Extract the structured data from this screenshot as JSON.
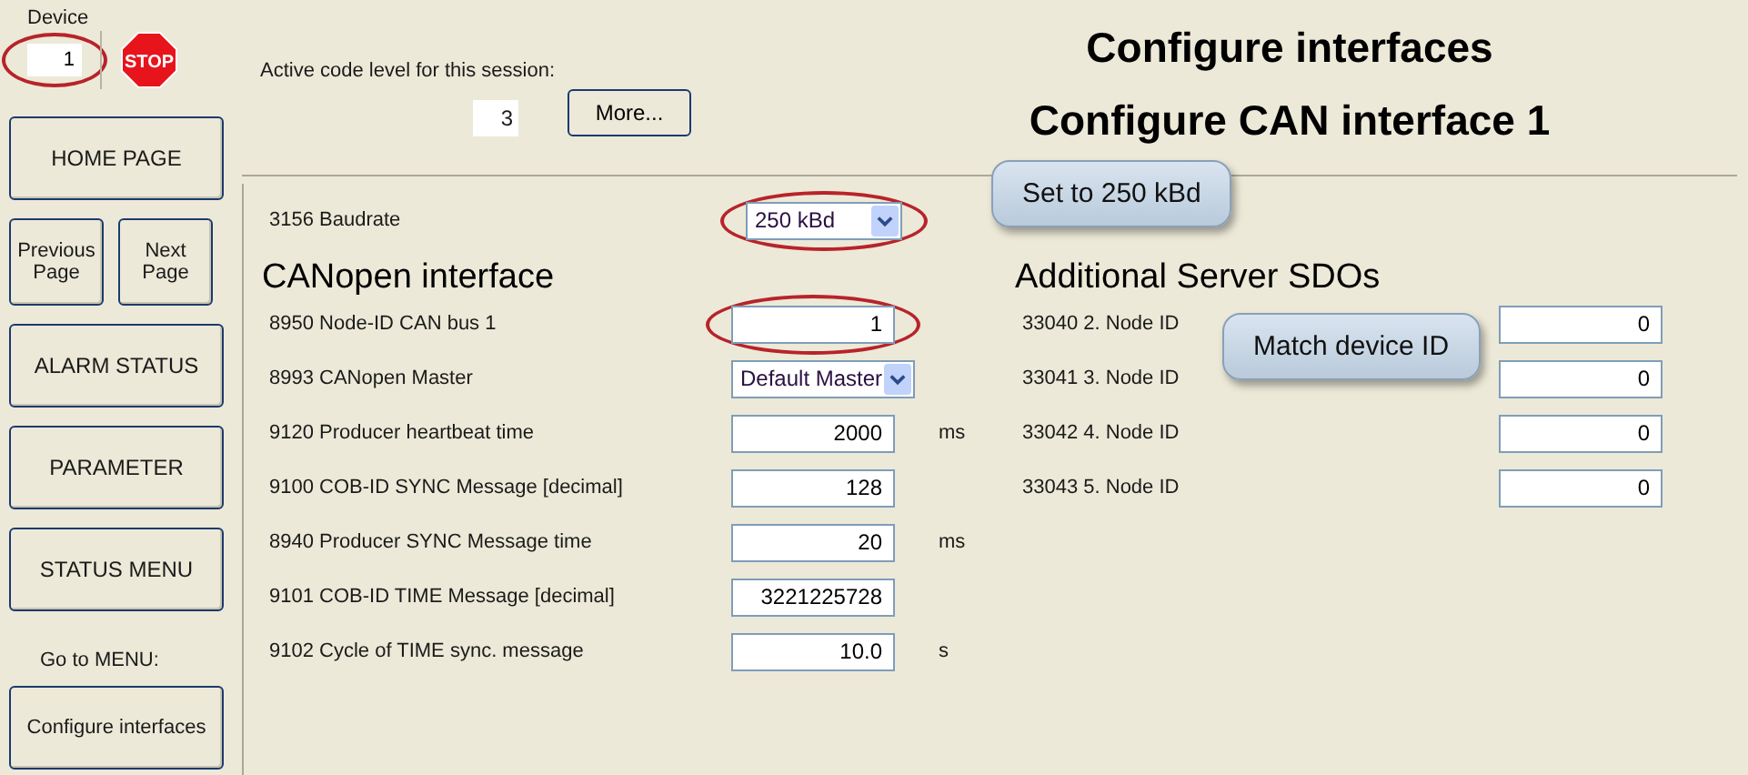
{
  "device": {
    "label": "Device",
    "value": "1",
    "highlighted": true
  },
  "stop_sign": {
    "label": "STOP"
  },
  "code_level": {
    "label": "Active code level for this session:",
    "value": "3",
    "button": "More..."
  },
  "titles": [
    "Configure interfaces",
    "Configure CAN interface 1"
  ],
  "sidebar": [
    {
      "kind": "button",
      "label": "HOME PAGE"
    },
    {
      "kind": "pair",
      "buttons": [
        "Previous Page",
        "Next Page"
      ]
    },
    {
      "kind": "button",
      "label": "ALARM STATUS"
    },
    {
      "kind": "button",
      "label": "PARAMETER"
    },
    {
      "kind": "button",
      "label": "STATUS MENU"
    },
    {
      "kind": "caption",
      "label": "Go to MENU:"
    },
    {
      "kind": "button",
      "label": "Configure interfaces"
    }
  ],
  "baudrate": {
    "label": "3156 Baudrate",
    "value": "250 kBd",
    "highlighted": true,
    "callout": "Set to 250 kBd"
  },
  "canopen": {
    "title": "CANopen interface",
    "rows": [
      {
        "label": "8950 Node-ID CAN bus 1",
        "kind": "input",
        "value": "1",
        "highlighted": true,
        "callout": "Match device ID"
      },
      {
        "label": "8993 CANopen Master",
        "kind": "select",
        "value": "Default Master",
        "highlighted": false
      },
      {
        "label": "9120 Producer heartbeat time",
        "kind": "input",
        "value": "2000",
        "unit": "ms",
        "highlighted": false
      },
      {
        "label": "9100 COB-ID SYNC Message [decimal]",
        "kind": "input",
        "value": "128",
        "highlighted": false
      },
      {
        "label": "8940 Producer SYNC Message time",
        "kind": "input",
        "value": "20",
        "unit": "ms",
        "highlighted": false
      },
      {
        "label": "9101 COB-ID TIME Message [decimal]",
        "kind": "input",
        "value": "3221225728",
        "highlighted": false
      },
      {
        "label": "9102 Cycle of TIME sync. message",
        "kind": "input",
        "value": "10.0",
        "unit": "s",
        "highlighted": false
      }
    ]
  },
  "server_sdos": {
    "title": "Additional Server SDOs",
    "rows": [
      {
        "label": "33040 2. Node ID",
        "value": "0"
      },
      {
        "label": "33041 3. Node ID",
        "value": "0"
      },
      {
        "label": "33042 4. Node ID",
        "value": "0"
      },
      {
        "label": "33043 5. Node ID",
        "value": "0"
      }
    ]
  }
}
